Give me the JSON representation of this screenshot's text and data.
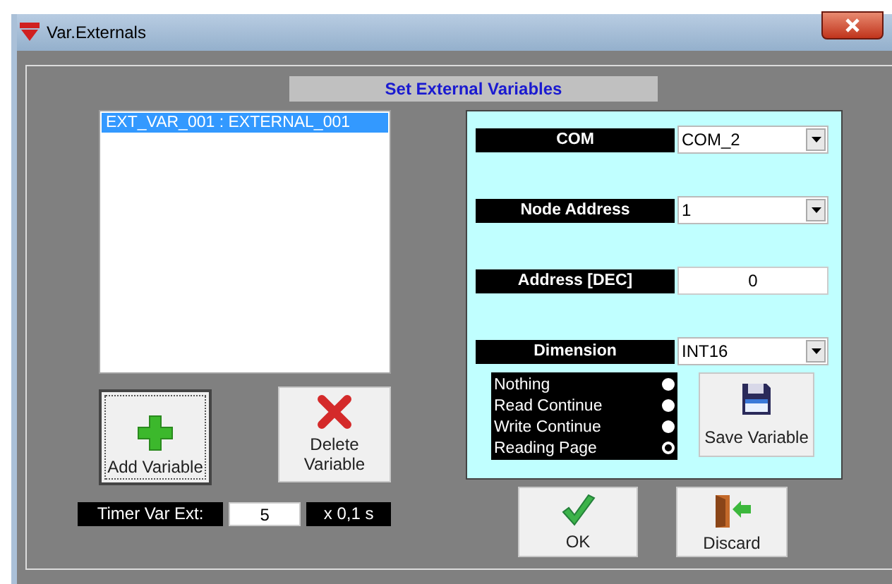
{
  "window": {
    "title": "Var.Externals"
  },
  "header": "Set External Variables",
  "variables": [
    {
      "label": "EXT_VAR_001 : EXTERNAL_001",
      "selected": true
    }
  ],
  "left_buttons": [
    {
      "label": "Add Variable",
      "kind": "add",
      "focused": true
    },
    {
      "label": "Delete Variable",
      "kind": "delete",
      "focused": false
    }
  ],
  "timer": {
    "label": "Timer Var Ext:",
    "value": "5",
    "unit": "x 0,1 s"
  },
  "fields": [
    {
      "label": "COM",
      "kind": "combo",
      "value": "COM_2"
    },
    {
      "label": "Node Address",
      "kind": "combo",
      "value": "1"
    },
    {
      "label": "Address [DEC]",
      "kind": "text",
      "value": "0"
    },
    {
      "label": "Dimension",
      "kind": "combo",
      "value": "INT16"
    }
  ],
  "modes": [
    {
      "label": "Nothing",
      "selected": false
    },
    {
      "label": "Read Continue",
      "selected": false
    },
    {
      "label": "Write Continue",
      "selected": false
    },
    {
      "label": "Reading Page",
      "selected": true
    }
  ],
  "save_button": "Save Variable",
  "buttons": [
    {
      "label": "OK",
      "kind": "ok"
    },
    {
      "label": "Discard",
      "kind": "discard"
    }
  ]
}
